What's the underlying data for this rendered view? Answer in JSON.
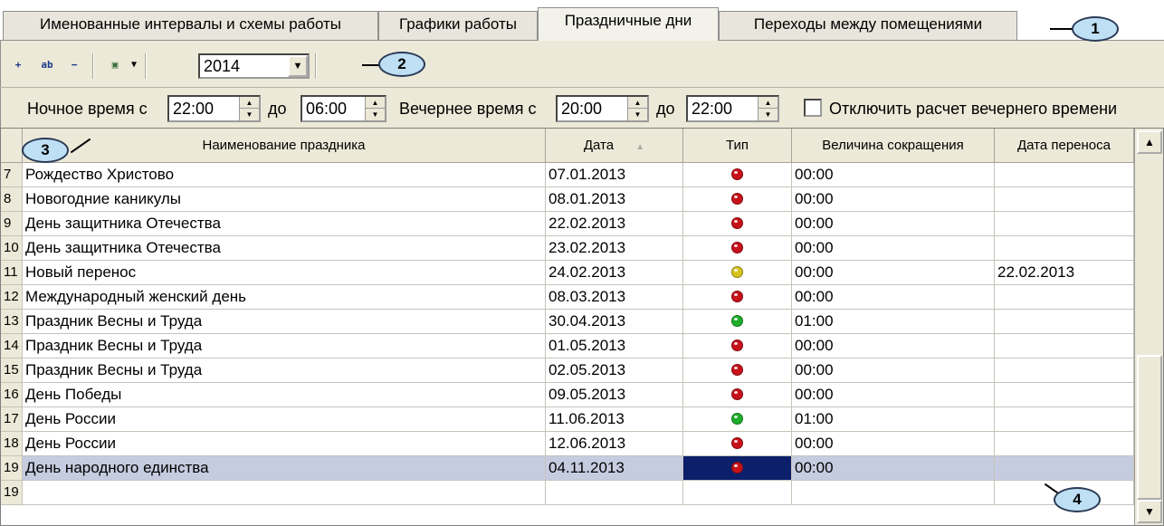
{
  "tabs": [
    {
      "label": "Именованные интервалы и схемы работы",
      "active": false
    },
    {
      "label": "Графики работы",
      "active": false
    },
    {
      "label": "Праздничные дни",
      "active": true
    },
    {
      "label": "Переходы между помещениями",
      "active": false
    }
  ],
  "toolbar": {
    "add_icon": "add-row-icon",
    "edit_icon": "edit-row-icon",
    "delete_icon": "delete-row-icon",
    "image_icon": "image-dropdown-icon",
    "year_value": "2014"
  },
  "times": {
    "night_label": "Ночное время с",
    "night_from": "22:00",
    "to_label": "до",
    "night_to": "06:00",
    "evening_label": "Вечернее время с",
    "evening_from": "20:00",
    "evening_to": "22:00",
    "disable_evening_label": "Отключить расчет вечернего времени"
  },
  "grid": {
    "columns": [
      "Наименование праздника",
      "Дата",
      "Тип",
      "Величина сокращения",
      "Дата переноса"
    ],
    "rows": [
      {
        "num": "7",
        "name": "Рождество Христово",
        "date": "07.01.2013",
        "type": "red",
        "reduction": "00:00",
        "transfer": ""
      },
      {
        "num": "8",
        "name": "Новогодние каникулы",
        "date": "08.01.2013",
        "type": "red",
        "reduction": "00:00",
        "transfer": ""
      },
      {
        "num": "9",
        "name": "День защитника Отечества",
        "date": "22.02.2013",
        "type": "red",
        "reduction": "00:00",
        "transfer": ""
      },
      {
        "num": "10",
        "name": "День защитника Отечества",
        "date": "23.02.2013",
        "type": "red",
        "reduction": "00:00",
        "transfer": ""
      },
      {
        "num": "11",
        "name": "Новый перенос",
        "date": "24.02.2013",
        "type": "yellow",
        "reduction": "00:00",
        "transfer": "22.02.2013"
      },
      {
        "num": "12",
        "name": "Международный женский день",
        "date": "08.03.2013",
        "type": "red",
        "reduction": "00:00",
        "transfer": ""
      },
      {
        "num": "13",
        "name": "Праздник Весны и Труда",
        "date": "30.04.2013",
        "type": "green",
        "reduction": "01:00",
        "transfer": ""
      },
      {
        "num": "14",
        "name": "Праздник Весны и Труда",
        "date": "01.05.2013",
        "type": "red",
        "reduction": "00:00",
        "transfer": ""
      },
      {
        "num": "15",
        "name": "Праздник Весны и Труда",
        "date": "02.05.2013",
        "type": "red",
        "reduction": "00:00",
        "transfer": ""
      },
      {
        "num": "16",
        "name": "День Победы",
        "date": "09.05.2013",
        "type": "red",
        "reduction": "00:00",
        "transfer": ""
      },
      {
        "num": "17",
        "name": "День России",
        "date": "11.06.2013",
        "type": "green",
        "reduction": "01:00",
        "transfer": ""
      },
      {
        "num": "18",
        "name": "День России",
        "date": "12.06.2013",
        "type": "red",
        "reduction": "00:00",
        "transfer": ""
      },
      {
        "num": "19 ▶",
        "name": "День народного единства",
        "date": "04.11.2013",
        "type": "red",
        "reduction": "00:00",
        "transfer": "",
        "selected": true
      },
      {
        "num": "19",
        "name": "",
        "date": "",
        "type": "",
        "reduction": "",
        "transfer": ""
      }
    ]
  },
  "colors": {
    "red": "#c8121a",
    "yellow": "#d8c420",
    "green": "#1fae2a"
  },
  "callouts": [
    "1",
    "2",
    "3",
    "4"
  ]
}
